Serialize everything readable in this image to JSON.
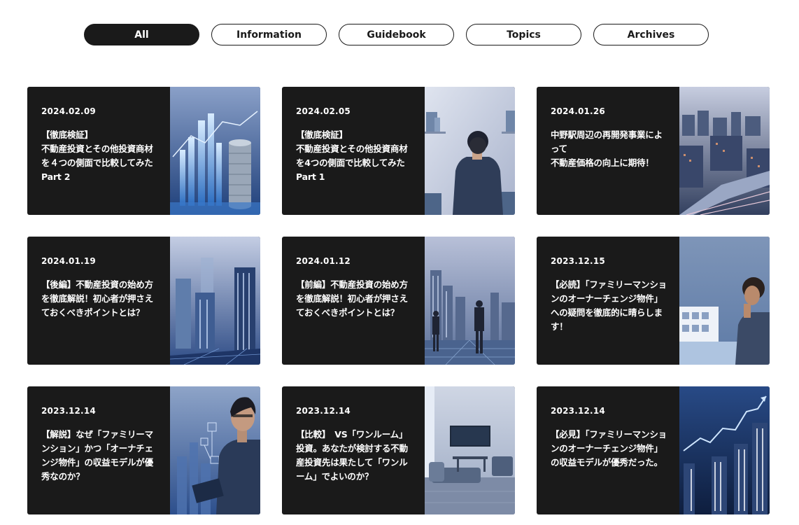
{
  "tabs": [
    {
      "label": "All",
      "active": true
    },
    {
      "label": "Information",
      "active": false
    },
    {
      "label": "Guidebook",
      "active": false
    },
    {
      "label": "Topics",
      "active": false
    },
    {
      "label": "Archives",
      "active": false
    }
  ],
  "articles": [
    {
      "date": "2024.02.09",
      "title": "【徹底検証】\n不動産投資とその他投資商材を４つの側面で比較してみた\nPart 2"
    },
    {
      "date": "2024.02.05",
      "title": "【徹底検証】\n不動産投資とその他投資商材を4つの側面で比較してみた\nPart 1"
    },
    {
      "date": "2024.01.26",
      "title": "中野駅周辺の再開発事業によって\n不動産価格の向上に期待！"
    },
    {
      "date": "2024.01.19",
      "title": "【後編】不動産投資の始め方を徹底解説！初心者が押さえておくべきポイントとは？"
    },
    {
      "date": "2024.01.12",
      "title": "【前編】不動産投資の始め方を徹底解説！初心者が押さえておくべきポイントとは？"
    },
    {
      "date": "2023.12.15",
      "title": "【必読】「ファミリーマンションのオーナーチェンジ物件」への疑問を徹底的に晴らします！"
    },
    {
      "date": "2023.12.14",
      "title": "【解説】なぜ「ファミリーマンション」かつ「オーナチェンジ物件」の収益モデルが優秀なのか？"
    },
    {
      "date": "2023.12.14",
      "title": "【比較】　VS「ワンルーム」投資。あなたが検討する不動産投資先は果たして「ワンルーム」でよいのか？"
    },
    {
      "date": "2023.12.14",
      "title": "【必見】「ファミリーマンションのオーナーチェンジ物件」の収益モデルが優秀だった。"
    }
  ]
}
